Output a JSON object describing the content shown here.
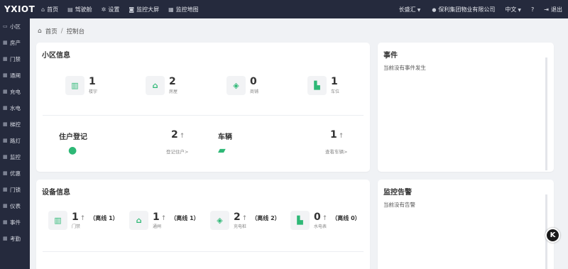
{
  "brand": "YXIOT",
  "topnav": [
    {
      "icon": "home-icon",
      "glyph": "⌂",
      "label": "首页"
    },
    {
      "icon": "dashboard-icon",
      "glyph": "▤",
      "label": "驾驶舱"
    },
    {
      "icon": "gear-icon",
      "glyph": "✲",
      "label": "设置"
    },
    {
      "icon": "camera-icon",
      "glyph": "◙",
      "label": "监控大屏"
    },
    {
      "icon": "map-icon",
      "glyph": "▦",
      "label": "监控地图"
    }
  ],
  "topright": {
    "community": "长盛汇",
    "company": "保利集团物业有限公司",
    "language": "中文",
    "help_glyph": "?",
    "logout": "退出"
  },
  "sidebar": [
    {
      "label": "小区",
      "icon": "monitor-icon",
      "glyph": "▭"
    },
    {
      "label": "房产",
      "icon": "grid-icon",
      "glyph": "▦"
    },
    {
      "label": "门禁",
      "icon": "grid-icon",
      "glyph": "▦"
    },
    {
      "label": "通闸",
      "icon": "grid-icon",
      "glyph": "▦"
    },
    {
      "label": "充电",
      "icon": "grid-icon",
      "glyph": "▦"
    },
    {
      "label": "水电",
      "icon": "grid-icon",
      "glyph": "▦"
    },
    {
      "label": "梯控",
      "icon": "grid-icon",
      "glyph": "▦"
    },
    {
      "label": "路灯",
      "icon": "grid-icon",
      "glyph": "▦"
    },
    {
      "label": "监控",
      "icon": "grid-icon",
      "glyph": "▦"
    },
    {
      "label": "优惠",
      "icon": "grid-icon",
      "glyph": "▦"
    },
    {
      "label": "门锁",
      "icon": "grid-icon",
      "glyph": "▦"
    },
    {
      "label": "仪表",
      "icon": "grid-icon",
      "glyph": "▦"
    },
    {
      "label": "事件",
      "icon": "grid-icon",
      "glyph": "▦"
    },
    {
      "label": "考勤",
      "icon": "grid-icon",
      "glyph": "▦"
    }
  ],
  "breadcrumb": {
    "home": "首页",
    "sep": "/",
    "current": "控制台"
  },
  "community_info": {
    "title": "小区信息",
    "stats": [
      {
        "icon": "building-icon",
        "glyph": "▥",
        "num": "1",
        "label": "楼宇"
      },
      {
        "icon": "house-icon",
        "glyph": "⌂",
        "num": "2",
        "label": "房屋"
      },
      {
        "icon": "box-icon",
        "glyph": "◈",
        "num": "0",
        "label": "商铺"
      },
      {
        "icon": "truck-icon",
        "glyph": "▙",
        "num": "1",
        "label": "车位"
      }
    ],
    "resident": {
      "title": "住户登记",
      "num": "2",
      "arrow": "↑",
      "link": "登记住户>"
    },
    "vehicle": {
      "title": "车辆",
      "num": "1",
      "arrow": "↑",
      "link": "查看车辆>"
    }
  },
  "events": {
    "title": "事件",
    "empty": "当前没有事件发生"
  },
  "device_info": {
    "title": "设备信息",
    "stats": [
      {
        "icon": "building-icon",
        "glyph": "▥",
        "num": "1",
        "arrow": "↑",
        "offline": "（离线 1）",
        "label": "门禁"
      },
      {
        "icon": "house-icon",
        "glyph": "⌂",
        "num": "1",
        "arrow": "↑",
        "offline": "（离线 1）",
        "label": "通闸"
      },
      {
        "icon": "box-icon",
        "glyph": "◈",
        "num": "2",
        "arrow": "↑",
        "offline": "（离线 2）",
        "label": "充电桩"
      },
      {
        "icon": "truck-icon",
        "glyph": "▙",
        "num": "0",
        "arrow": "↑",
        "offline": "（离线 0）",
        "label": "水电表"
      }
    ]
  },
  "monitor_alert": {
    "title": "监控告警",
    "empty": "当前没有告警"
  },
  "float_button": "K",
  "colors": {
    "sidebar_bg": "#252a3d",
    "accent_green": "#2eb876",
    "page_bg": "#f0f2f5"
  }
}
